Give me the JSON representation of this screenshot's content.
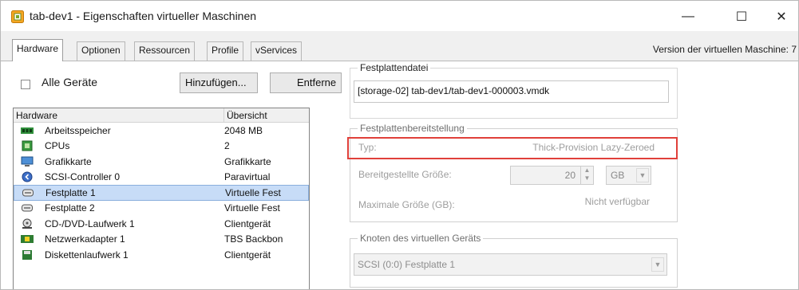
{
  "window": {
    "title": "tab-dev1 - Eigenschaften virtueller Maschinen",
    "minimize_glyph": "—",
    "maximize_glyph": "☐",
    "close_glyph": "✕"
  },
  "tabs": [
    {
      "label": "Hardware",
      "active": true
    },
    {
      "label": "Optionen",
      "active": false
    },
    {
      "label": "Ressourcen",
      "active": false
    },
    {
      "label": "Profile",
      "active": false
    },
    {
      "label": "vServices",
      "active": false
    }
  ],
  "version_text": "Version der virtuellen Maschine: 7",
  "left": {
    "all_devices_label": "Alle Geräte",
    "all_devices_checked": false,
    "add_button": "Hinzufügen...",
    "remove_button": "Entferne"
  },
  "hardware_list": {
    "columns": [
      "Hardware",
      "Übersicht"
    ],
    "rows": [
      {
        "icon": "memory-icon",
        "name": "Arbeitsspeicher",
        "summary": "2048 MB",
        "selected": false
      },
      {
        "icon": "cpu-icon",
        "name": "CPUs",
        "summary": "2",
        "selected": false
      },
      {
        "icon": "display-icon",
        "name": "Grafikkarte",
        "summary": "Grafikkarte",
        "selected": false
      },
      {
        "icon": "scsi-controller-icon",
        "name": "SCSI-Controller 0",
        "summary": "Paravirtual",
        "selected": false
      },
      {
        "icon": "hard-disk-icon",
        "name": "Festplatte 1",
        "summary": "Virtuelle Fest",
        "selected": true
      },
      {
        "icon": "hard-disk-icon",
        "name": "Festplatte 2",
        "summary": "Virtuelle Fest",
        "selected": false
      },
      {
        "icon": "cd-dvd-drive-icon",
        "name": "CD-/DVD-Laufwerk 1",
        "summary": "Clientgerät",
        "selected": false
      },
      {
        "icon": "network-adapter-icon",
        "name": "Netzwerkadapter 1",
        "summary": "TBS Backbon",
        "selected": false
      },
      {
        "icon": "floppy-drive-icon",
        "name": "Diskettenlaufwerk 1",
        "summary": "Clientgerät",
        "selected": false
      }
    ]
  },
  "disk_file": {
    "group_title": "Festplattendatei",
    "path": "[storage-02] tab-dev1/tab-dev1-000003.vmdk"
  },
  "provisioning": {
    "group_title": "Festplattenbereitstellung",
    "type_label": "Typ:",
    "type_value": "Thick-Provision Lazy-Zeroed",
    "size_label": "Bereitgestellte Größe:",
    "size_value": "20",
    "size_unit": "GB",
    "max_label": "Maximale Größe (GB):",
    "max_value": "Nicht verfügbar"
  },
  "device_node": {
    "group_title": "Knoten des virtuellen Geräts",
    "value": "SCSI (0:0) Festplatte 1"
  },
  "colors": {
    "highlight": "#e0403a",
    "selection": "#c7dcf7",
    "app_icon": "#e8a21f"
  }
}
